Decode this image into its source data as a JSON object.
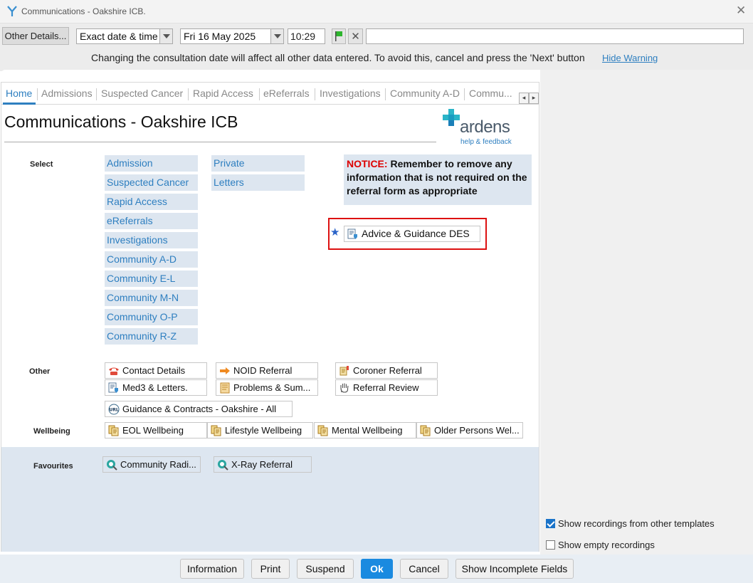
{
  "window": {
    "title": "Communications - Oakshire ICB."
  },
  "toolbar": {
    "other_details": "Other Details...",
    "date_mode": "Exact date & time",
    "date": "Fri 16 May 2025",
    "time": "10:29",
    "warning": "Changing the consultation date will affect all other data entered. To avoid this, cancel and press the 'Next' button",
    "hide_warning": "Hide Warning"
  },
  "tabs": [
    "Home",
    "Admissions",
    "Suspected Cancer",
    "Rapid Access",
    "eReferrals",
    "Investigations",
    "Community A-D",
    "Commu..."
  ],
  "page": {
    "title": "Communications - Oakshire ICB",
    "logo_text": "ardens",
    "logo_sub": "help & feedback",
    "select_label": "Select",
    "select_col1": [
      "Admission",
      "Suspected Cancer",
      "Rapid Access",
      "eReferrals",
      "Investigations",
      "Community A-D",
      "Community E-L",
      "Community M-N",
      "Community O-P",
      "Community R-Z"
    ],
    "select_col2": [
      "Private",
      "Letters"
    ],
    "notice_prefix": "NOTICE:",
    "notice_text": " Remember to remove any information that is not required on the referral form as appropriate",
    "featured": "Advice & Guidance DES",
    "other_label": "Other",
    "other": [
      "Contact Details",
      "NOID Referral",
      "Coroner Referral",
      "Med3 & Letters.",
      "Problems & Sum...",
      "Referral Review",
      "Guidance & Contracts - Oakshire - All"
    ],
    "wellbeing_label": "Wellbeing",
    "wellbeing": [
      "EOL Wellbeing",
      "Lifestyle Wellbeing",
      "Mental Wellbeing",
      "Older Persons Wel..."
    ],
    "favourites_label": "Favourites",
    "favourites": [
      "Community Radi...",
      "X-Ray Referral"
    ]
  },
  "options": {
    "show_other_templates": "Show recordings from other templates",
    "show_empty": "Show empty recordings"
  },
  "footer": {
    "information": "Information",
    "print": "Print",
    "suspend": "Suspend",
    "ok": "Ok",
    "cancel": "Cancel",
    "incomplete": "Show Incomplete Fields"
  },
  "colors": {
    "accent": "#2e7fc0",
    "notice_red": "#dd0000",
    "panel": "#dde6f0",
    "highlight_box": "#dd1111"
  }
}
